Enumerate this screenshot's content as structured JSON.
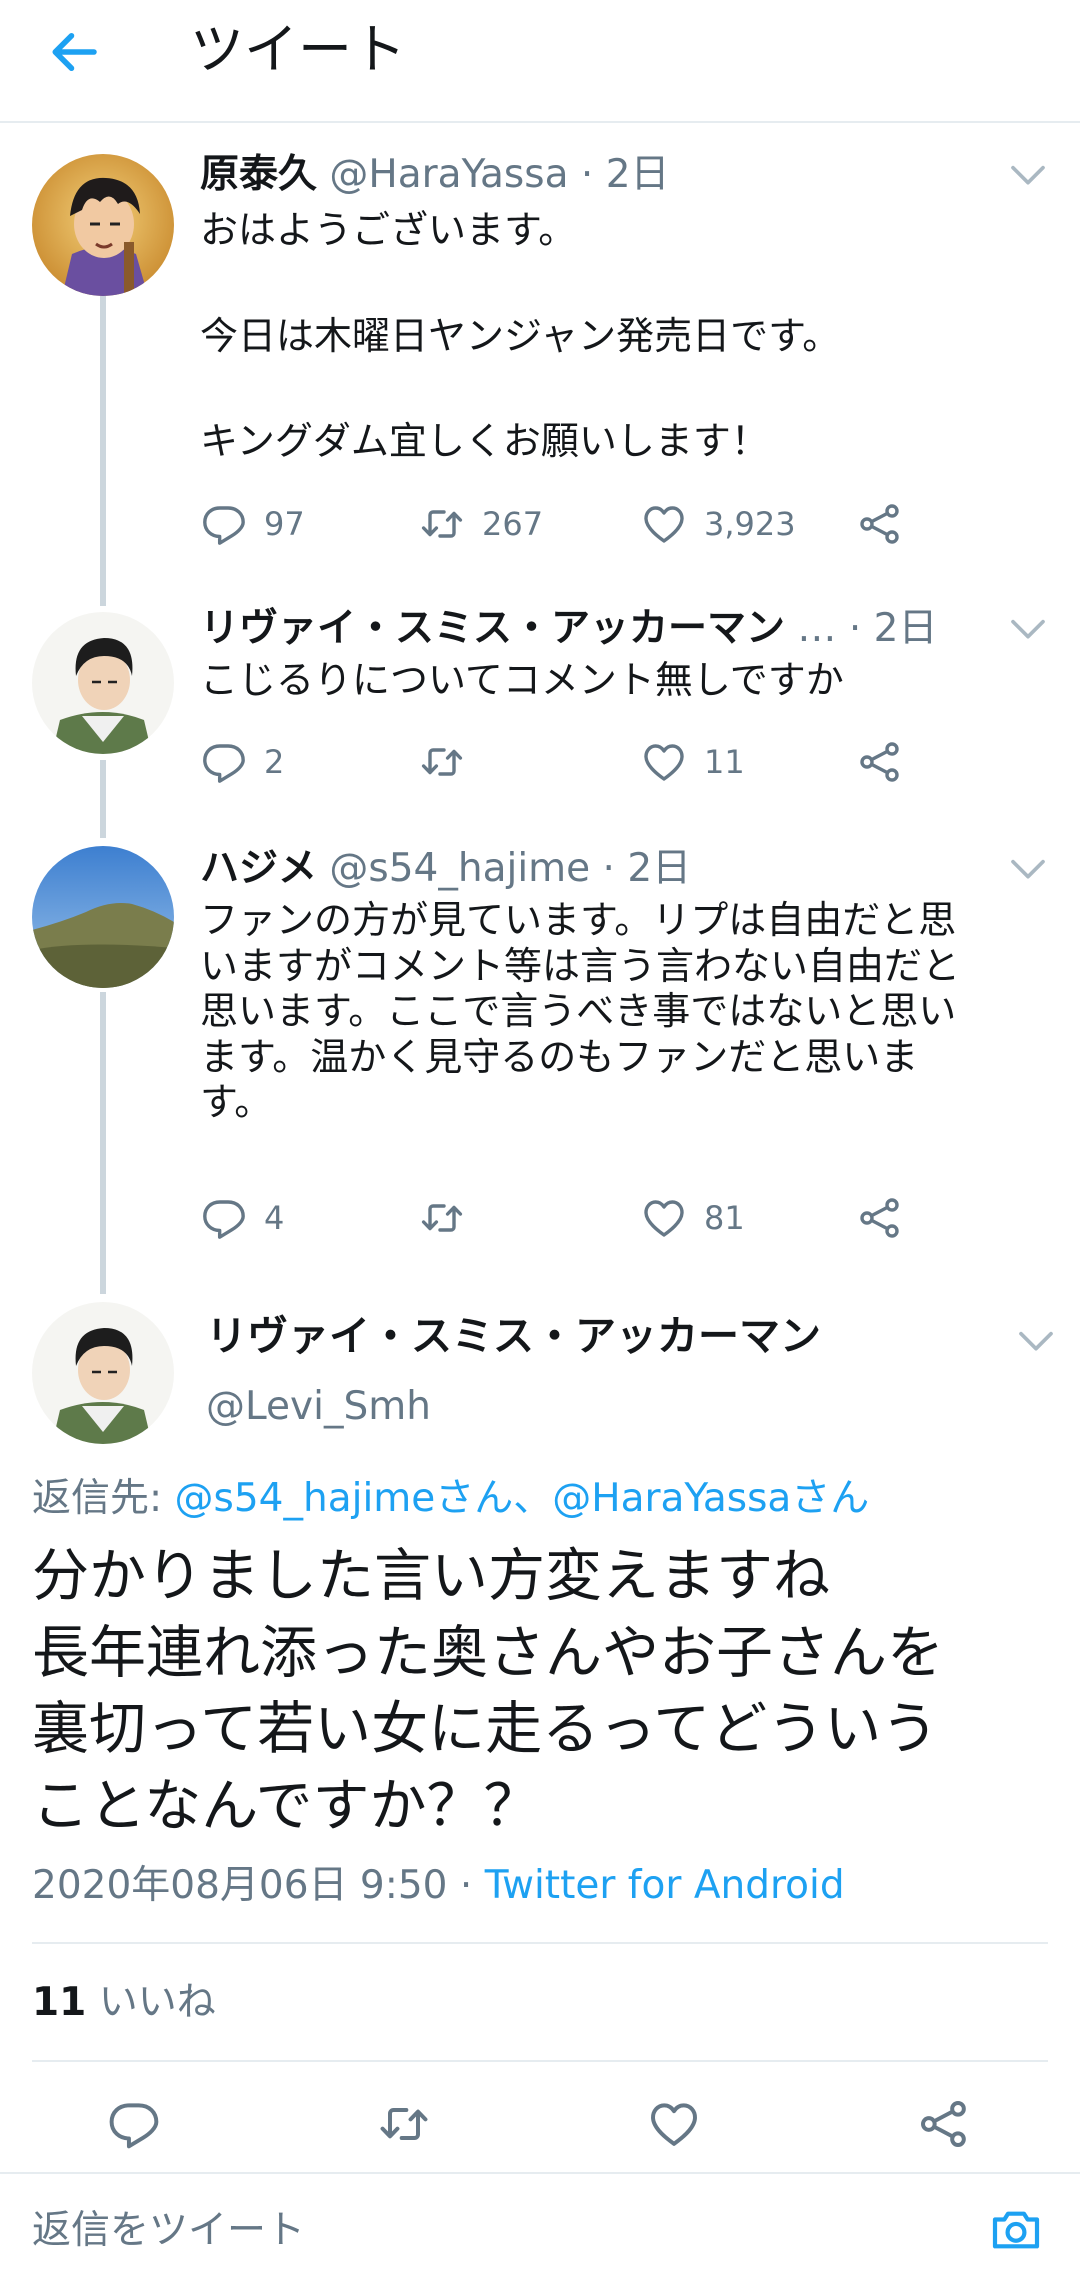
{
  "header": {
    "title": "ツイート"
  },
  "thread": [
    {
      "name": "原泰久",
      "handle": "@HaraYassa",
      "dot": "·",
      "time": "2日",
      "lines": [
        "おはようございます。",
        "",
        "今日は木曜日ヤンジャン発売日です。",
        "",
        "キングダム宜しくお願いします！"
      ],
      "replies": "97",
      "retweets": "267",
      "likes": "3,923"
    },
    {
      "name": "リヴァイ・スミス・アッカーマン",
      "handle": "…",
      "dot": "·",
      "time": "2日",
      "lines": [
        "こじるりについてコメント無しですか"
      ],
      "replies": "2",
      "retweets": "",
      "likes": "11"
    },
    {
      "name": "ハジメ",
      "handle": "@s54_hajime",
      "dot": "·",
      "time": "2日",
      "lines": [
        "ファンの方が見ています。リプは自由だと思",
        "いますがコメント等は言う言わない自由だと",
        "思います。ここで言うべき事ではないと思い",
        "ます。温かく見守るのもファンだと思いま",
        "す。"
      ],
      "replies": "4",
      "retweets": "",
      "likes": "81"
    }
  ],
  "main_tweet": {
    "name": "リヴァイ・スミス・アッカーマン",
    "handle": "@Levi_Smh",
    "reply_prefix": "返信先:",
    "reply_mentions": "@s54_hajimeさん、@HaraYassaさん",
    "lines": [
      "分かりました言い方変えますね",
      "長年連れ添った奥さんやお子さんを",
      "裏切って若い女に走るってどういう",
      "ことなんですか？？"
    ],
    "date": "2020年08月06日 9:50",
    "dot": "·",
    "source": "Twitter for Android",
    "like_count": "11",
    "like_label": "いいね"
  },
  "reply_bar": {
    "placeholder": "返信をツイート"
  },
  "icons": {
    "back": "arrow-left-icon",
    "caret": "chevron-down-icon",
    "reply": "reply-bubble-icon",
    "retweet": "retweet-icon",
    "like": "heart-icon",
    "share": "share-icon",
    "camera": "camera-icon"
  },
  "colors": {
    "accent": "#1da1f2",
    "text": "#14171a",
    "muted": "#657786",
    "divider": "#e6ecf0",
    "thread_line": "#ccd6dd"
  }
}
